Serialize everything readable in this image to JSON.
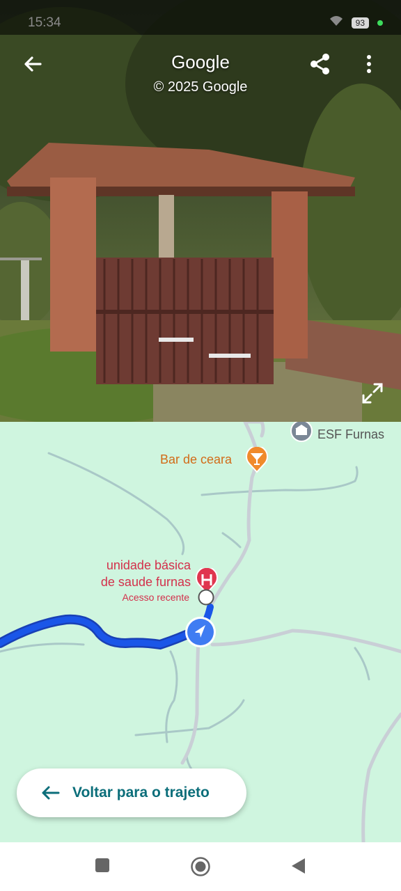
{
  "status_bar": {
    "time": "15:34",
    "battery": "93"
  },
  "street_view": {
    "title": "Google",
    "copyright": "© 2025 Google"
  },
  "map": {
    "pois": {
      "esf": "ESF Furnas",
      "bar": "Bar de ceara",
      "ubs_line1": "unidade básica",
      "ubs_line2": "de saude furnas",
      "recent": "Acesso recente"
    },
    "colors": {
      "land": "#cff5df",
      "route": "#1a56e8",
      "bar_pin": "#f08a2b",
      "hospital_pin": "#e0364f"
    }
  },
  "back_to_route": {
    "label": "Voltar para o trajeto"
  },
  "icons": [
    "back-arrow-icon",
    "share-icon",
    "more-vert-icon",
    "expand-icon",
    "martini-icon",
    "hospital-icon",
    "school-icon",
    "navigation-arrow-icon",
    "recent-circle-icon"
  ]
}
